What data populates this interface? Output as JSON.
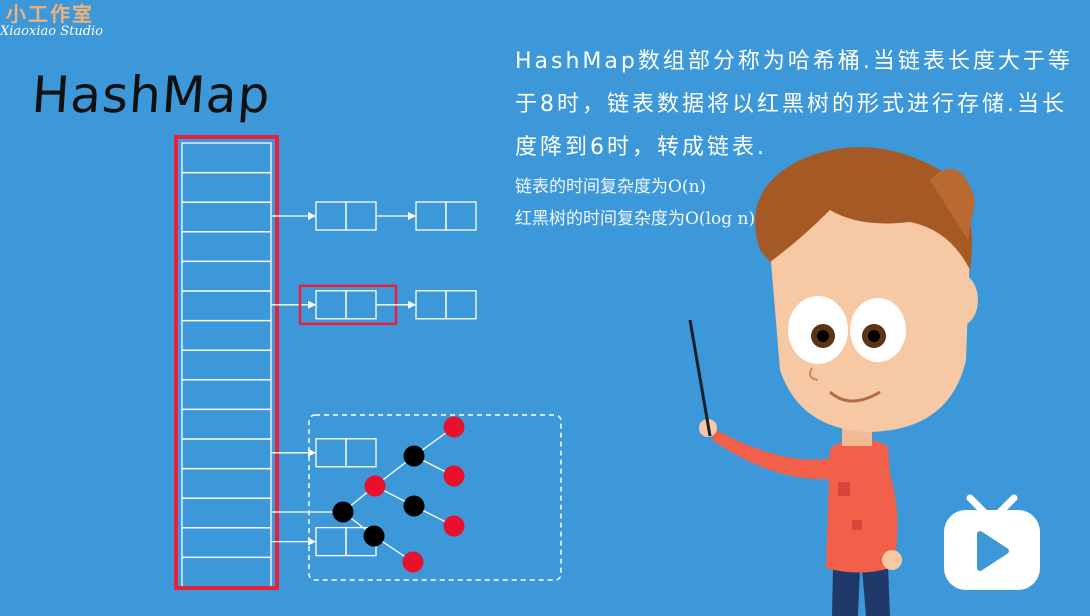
{
  "logo": {
    "cn": "小工作室",
    "en": "Xiaoxiao Studio"
  },
  "title": "HashMap",
  "description": "HashMap数组部分称为哈希桶.当链表长度大于等于8时，链表数据将以红黑树的形式进行存储.当长度降到6时，转成链表.",
  "notes": {
    "linked_list": "链表的时间复杂度为O(n)",
    "rb_tree": "红黑树的时间复杂度为O(log n)"
  },
  "diagram": {
    "bucket_count": 15,
    "chains": [
      {
        "bucket": 2,
        "nodes": 2
      },
      {
        "bucket": 5,
        "nodes": 2,
        "highlight_first": true
      },
      {
        "bucket": 10,
        "nodes": 1
      },
      {
        "bucket": 13,
        "nodes": 1
      }
    ],
    "tree_node_colors": [
      "black",
      "red",
      "black",
      "black",
      "red",
      "black",
      "red",
      "red",
      "red"
    ]
  },
  "colors": {
    "background": "#3d98d9",
    "highlight": "#e8203a",
    "tree_black": "#000000",
    "tree_red": "#e8102a",
    "line": "#ffffff"
  },
  "icons": [
    "play-icon",
    "tv-icon",
    "pointer-stick"
  ]
}
